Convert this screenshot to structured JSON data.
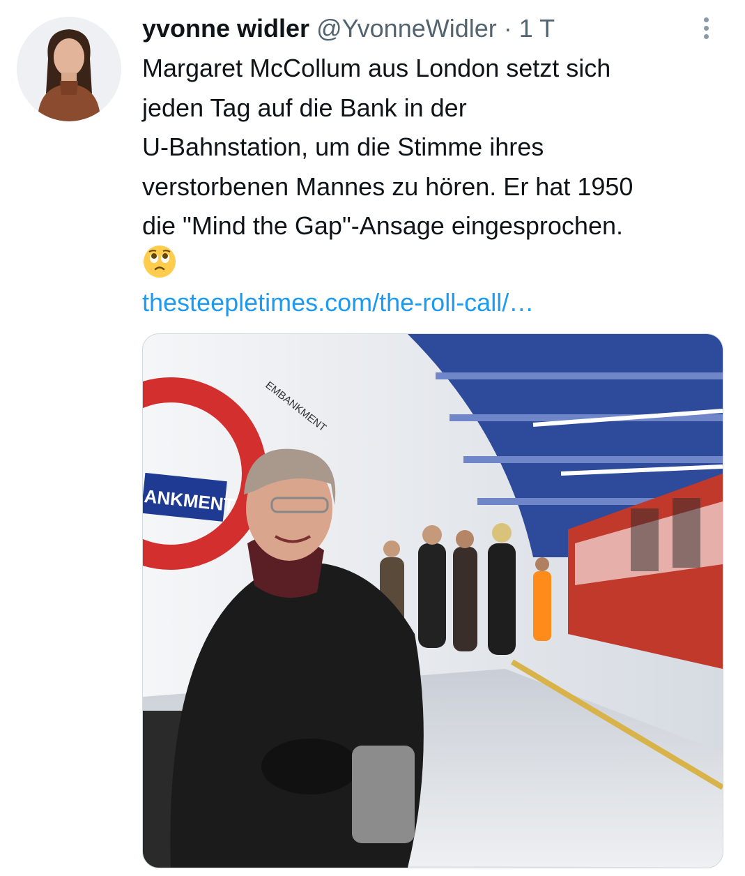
{
  "author": {
    "display_name": "yvonne widler",
    "handle": "@YvonneWidler",
    "separator": "·",
    "time": "1 T",
    "avatar_icon": "profile-photo"
  },
  "tweet": {
    "lines": [
      "Margaret McCollum aus London setzt sich",
      "jeden Tag auf die Bank in der",
      "U-Bahnstation, um die Stimme ihres",
      "verstorbenen Mannes zu hören. Er hat 1950",
      "die \"Mind the Gap\"-Ansage eingesprochen."
    ],
    "emoji": "face-holding-back-tears-emoji",
    "link": "thesteepletimes.com/the-roll-call/…"
  },
  "media": {
    "sign_text": "ANKMENT",
    "wall_text": "EMBANKMENT"
  },
  "colors": {
    "text": "#0f1419",
    "muted": "#536471",
    "link": "#1d9bf0"
  },
  "more_icon": "more-options-icon"
}
